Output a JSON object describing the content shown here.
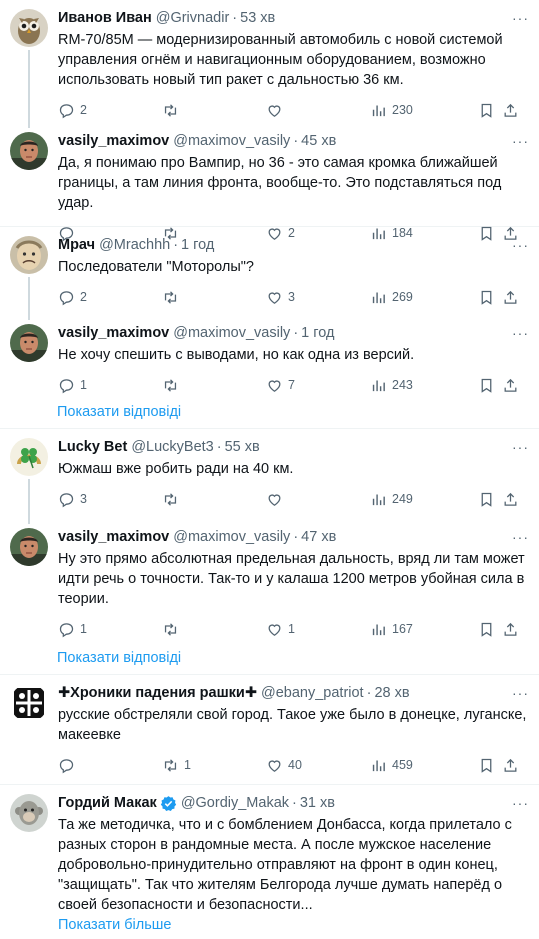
{
  "tweets": [
    {
      "name": "Иванов Иван",
      "handle": "@Grivnadir",
      "time": "53 хв",
      "text": "RM-70/85M — модернизированный автомобиль с новой системой управления огнём и навигационным оборудованием, возможно использовать новый тип ракет с дальностью 36 км.",
      "replies": "2",
      "retweets": "",
      "likes": "",
      "views": "230",
      "avatar": "owl-avatar"
    },
    {
      "name": "vasily_maximov",
      "handle": "@maximov_vasily",
      "time": "45 хв",
      "text": "Да, я понимаю про Вампир, но 36 - это самая кромка ближайшей границы, а там линия фронта, вообще-то. Это подставляться под удар.",
      "replies": "",
      "retweets": "",
      "likes": "2",
      "views": "184",
      "avatar": "man-avatar"
    },
    {
      "name": "Мрач",
      "handle": "@Mrachhh",
      "time": "1 год",
      "text": "Последователи \"Моторолы\"?",
      "replies": "2",
      "retweets": "",
      "likes": "3",
      "views": "269",
      "avatar": "face-avatar"
    },
    {
      "name": "vasily_maximov",
      "handle": "@maximov_vasily",
      "time": "1 год",
      "text": "Не хочу спешить с выводами, но как одна из версий.",
      "replies": "1",
      "retweets": "",
      "likes": "7",
      "views": "243",
      "avatar": "man-avatar"
    },
    {
      "name": "Lucky Bet",
      "handle": "@LuckyBet3",
      "time": "55 хв",
      "text": "Южмаш вже робить ради на 40 км.",
      "replies": "3",
      "retweets": "",
      "likes": "",
      "views": "249",
      "avatar": "clover-avatar"
    },
    {
      "name": "vasily_maximov",
      "handle": "@maximov_vasily",
      "time": "47 хв",
      "text": "Ну это прямо абсолютная предельная дальность, вряд ли там может идти речь о точности. Так-то и у калаша 1200 метров убойная сила в теории.",
      "replies": "1",
      "retweets": "",
      "likes": "1",
      "views": "167",
      "avatar": "man-avatar"
    },
    {
      "name": "✚Хроники падения рашки✚",
      "handle": "@ebany_patriot",
      "time": "28 хв",
      "text": "русские обстреляли свой город. Такое уже было в донецке, луганске, макеевке",
      "replies": "",
      "retweets": "1",
      "likes": "40",
      "views": "459",
      "avatar": "emblem-avatar"
    },
    {
      "name": "Гордий Макак",
      "handle": "@Gordiy_Makak",
      "time": "31 хв",
      "text": "Та же методичка, что и с бомблением Донбасса, когда прилетало с разных сторон в рандомные места. А после мужское население добровольно-принудительно отправляют на фронт в один конец, \"защищать\". Так что жителям Белгорода лучше думать наперёд о своей безопасности и безопасности...",
      "replies": "",
      "retweets": "",
      "likes": "",
      "views": "",
      "avatar": "monkey-avatar",
      "verified": true
    }
  ],
  "show_replies_label": "Показати відповіді",
  "show_more_label": "Показати більше",
  "colors": {
    "accent": "#1d9bf0",
    "muted": "#536471",
    "thread_line": "#cfd9de",
    "separator": "#eff3f4"
  }
}
